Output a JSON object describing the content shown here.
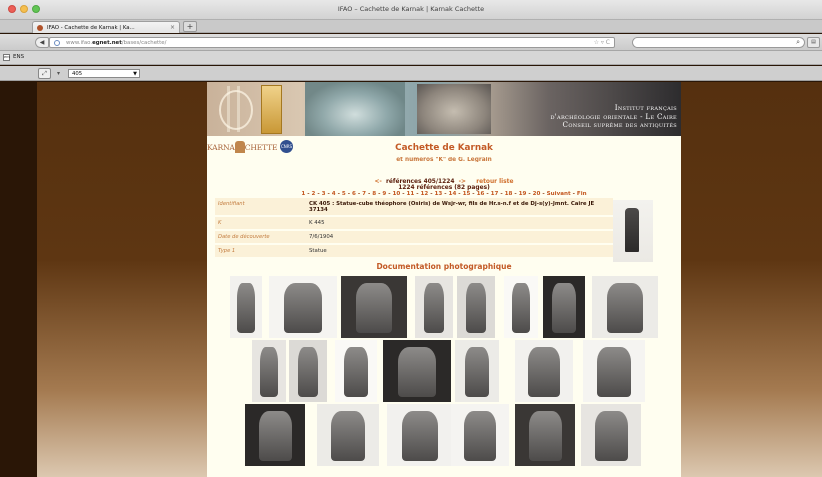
{
  "window": {
    "title": "IFAO – Cachette de Karnak | Karnak Cachette"
  },
  "tab": {
    "label": "IFAO - Cachette de Karnak | Ka..."
  },
  "nav": {
    "url_prefix": "www.ifao.",
    "url_host": "egnet.net",
    "url_path": "/bases/cachette/"
  },
  "bookmarks": [
    {
      "label": "ENS"
    }
  ],
  "toolbar": {
    "selected_value": "405"
  },
  "banner": {
    "line1": "Institut français",
    "line2": "d'archéologie orientale - Le Caire",
    "line3": "Conseil suprême des antiquités"
  },
  "logos": {
    "karnak_left": "KARNA",
    "karnak_right": "CHETTE",
    "cnrs": "CNRS"
  },
  "page": {
    "title": "Cachette de Karnak",
    "subtitle": "et numéros \"K\" de G. Legrain",
    "pager": {
      "prev": "<-",
      "current": "références 405/1224",
      "next": "->",
      "back_to_list": "retour liste",
      "summary": "1224 références (82 pages)",
      "pages": [
        "1",
        "2",
        "3",
        "4",
        "5",
        "6",
        "7",
        "8",
        "9",
        "10",
        "11",
        "12",
        "13",
        "14",
        "15",
        "16",
        "17",
        "18",
        "19",
        "20"
      ],
      "suivant": "Suivant",
      "fin": "Fin"
    },
    "fields": [
      {
        "label": "Identifiant",
        "value": "CK 405 : Statue-cube théophore (Osiris) de Wsjr-wr, fils de Hr.s-n.f et de Dj-s(y)-Jmnt. Caire JE 37134"
      },
      {
        "label": "K",
        "value": "K 445"
      },
      {
        "label": "Date de découverte",
        "value": "7/6/1904"
      },
      {
        "label": "Type 1",
        "value": "Statue"
      }
    ],
    "doc_heading": "Documentation photographique"
  },
  "colors": {
    "accent": "#c35a26",
    "background": "#fffef0",
    "side": "#5e3612"
  }
}
